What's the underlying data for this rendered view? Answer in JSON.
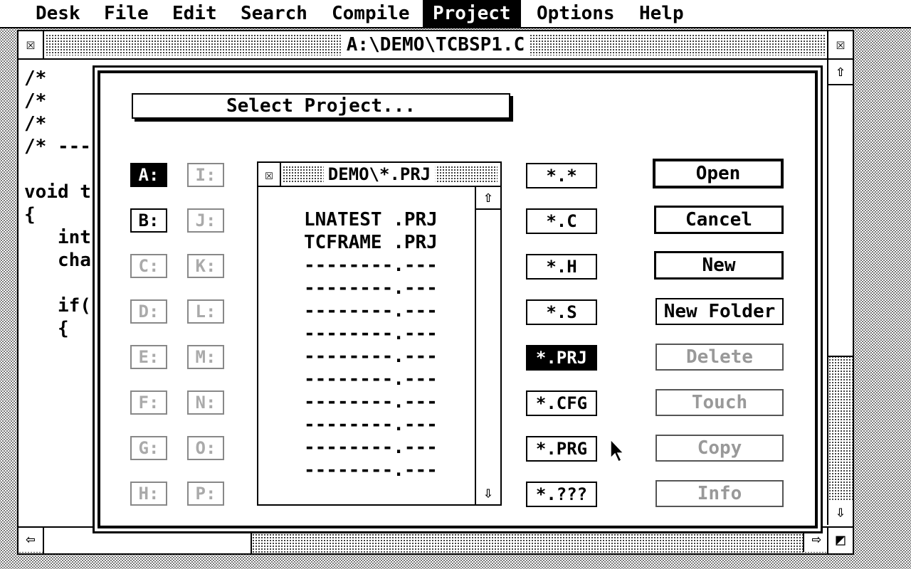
{
  "menubar": {
    "items": [
      {
        "label": "Desk",
        "active": false
      },
      {
        "label": "File",
        "active": false
      },
      {
        "label": "Edit",
        "active": false
      },
      {
        "label": "Search",
        "active": false
      },
      {
        "label": "Compile",
        "active": false
      },
      {
        "label": "Project",
        "active": true
      },
      {
        "label": "Options",
        "active": false
      },
      {
        "label": "Help",
        "active": false
      }
    ]
  },
  "window": {
    "title": "A:\\DEMO\\TCBSP1.C",
    "closer_icon": "close-box-icon",
    "fuller_icon": "full-box-icon",
    "code_lines": [
      "/*",
      "/*",
      "/*",
      "/* ---",
      "",
      "void t",
      "{",
      "   int",
      "   cha",
      "",
      "   if(",
      "   {"
    ]
  },
  "dialog": {
    "title": "Select Project...",
    "drives_left": [
      {
        "label": "A:",
        "state": "selected"
      },
      {
        "label": "B:",
        "state": "enabled"
      },
      {
        "label": "C:",
        "state": "disabled"
      },
      {
        "label": "D:",
        "state": "disabled"
      },
      {
        "label": "E:",
        "state": "disabled"
      },
      {
        "label": "F:",
        "state": "disabled"
      },
      {
        "label": "G:",
        "state": "disabled"
      },
      {
        "label": "H:",
        "state": "disabled"
      }
    ],
    "drives_right": [
      {
        "label": "I:",
        "state": "disabled"
      },
      {
        "label": "J:",
        "state": "disabled"
      },
      {
        "label": "K:",
        "state": "disabled"
      },
      {
        "label": "L:",
        "state": "disabled"
      },
      {
        "label": "M:",
        "state": "disabled"
      },
      {
        "label": "N:",
        "state": "disabled"
      },
      {
        "label": "O:",
        "state": "disabled"
      },
      {
        "label": "P:",
        "state": "disabled"
      }
    ],
    "file_window": {
      "title": "DEMO\\*.PRJ",
      "files": [
        "LNATEST .PRJ",
        "TCFRAME .PRJ",
        "--------.---",
        "--------.---",
        "--------.---",
        "--------.---",
        "--------.---",
        "--------.---",
        "--------.---",
        "--------.---",
        "--------.---",
        "--------.---"
      ]
    },
    "filters": [
      {
        "label": "*.*",
        "selected": false
      },
      {
        "label": "*.C",
        "selected": false
      },
      {
        "label": "*.H",
        "selected": false
      },
      {
        "label": "*.S",
        "selected": false
      },
      {
        "label": "*.PRJ",
        "selected": true
      },
      {
        "label": "*.CFG",
        "selected": false
      },
      {
        "label": "*.PRG",
        "selected": false
      },
      {
        "label": "*.???",
        "selected": false
      }
    ],
    "buttons": [
      {
        "label": "Open",
        "state": "default"
      },
      {
        "label": "Cancel",
        "state": "bold"
      },
      {
        "label": "New",
        "state": "bold"
      },
      {
        "label": "New Folder",
        "state": "enabled"
      },
      {
        "label": "Delete",
        "state": "disabled"
      },
      {
        "label": "Touch",
        "state": "disabled"
      },
      {
        "label": "Copy",
        "state": "disabled"
      },
      {
        "label": "Info",
        "state": "disabled"
      }
    ]
  }
}
